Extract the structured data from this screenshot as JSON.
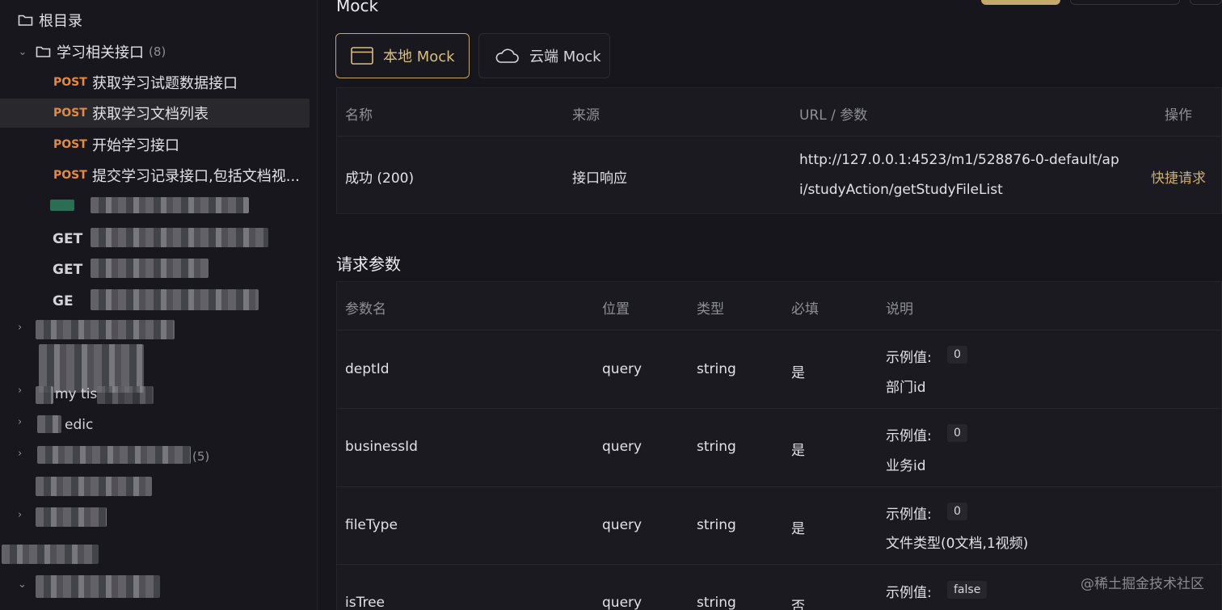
{
  "sidebar": {
    "root": {
      "label": "根目录"
    },
    "folder": {
      "label": "学习相关接口",
      "count": "(8)"
    },
    "endpoints": [
      {
        "method": "POST",
        "name": "获取学习试题数据接口"
      },
      {
        "method": "POST",
        "name": "获取学习文档列表"
      },
      {
        "method": "POST",
        "name": "开始学习接口"
      },
      {
        "method": "POST",
        "name": "提交学习记录接口,包括文档视..."
      }
    ],
    "partial_items": [
      {
        "text": "GET"
      },
      {
        "text": "GET"
      },
      {
        "text": "GE"
      },
      {
        "text": "my  tis"
      },
      {
        "text": "edic"
      },
      {
        "text": "(5)"
      }
    ]
  },
  "mock": {
    "title": "Mock",
    "tabs": [
      {
        "label": "本地 Mock",
        "icon": "browser-window-icon",
        "active": true
      },
      {
        "label": "云端 Mock",
        "icon": "cloud-icon",
        "active": false
      }
    ],
    "headers": [
      "名称",
      "来源",
      "URL / 参数",
      "操作"
    ],
    "row": {
      "name": "成功 (200)",
      "source": "接口响应",
      "url_line1": "http://127.0.0.1:4523/m1/528876-0-default/ap",
      "url_line2": "i/studyAction/getStudyFileList",
      "action": "快捷请求"
    }
  },
  "params": {
    "title": "请求参数",
    "headers": [
      "参数名",
      "位置",
      "类型",
      "必填",
      "说明"
    ],
    "example_label": "示例值:",
    "rows": [
      {
        "name": "deptId",
        "in": "query",
        "type": "string",
        "required": "是",
        "example": "0",
        "desc": "部门id"
      },
      {
        "name": "businessId",
        "in": "query",
        "type": "string",
        "required": "是",
        "example": "0",
        "desc": "业务id"
      },
      {
        "name": "fileType",
        "in": "query",
        "type": "string",
        "required": "是",
        "example": "0",
        "desc": "文件类型(0文档,1视频)"
      },
      {
        "name": "isTree",
        "in": "query",
        "type": "string",
        "required": "否",
        "example": "false",
        "desc": ""
      }
    ]
  },
  "watermark": "@稀土掘金技术社区",
  "colors": {
    "accent": "#c9ad72",
    "post": "#e8893d",
    "get": "#3fb27f",
    "background": "#16161c"
  }
}
